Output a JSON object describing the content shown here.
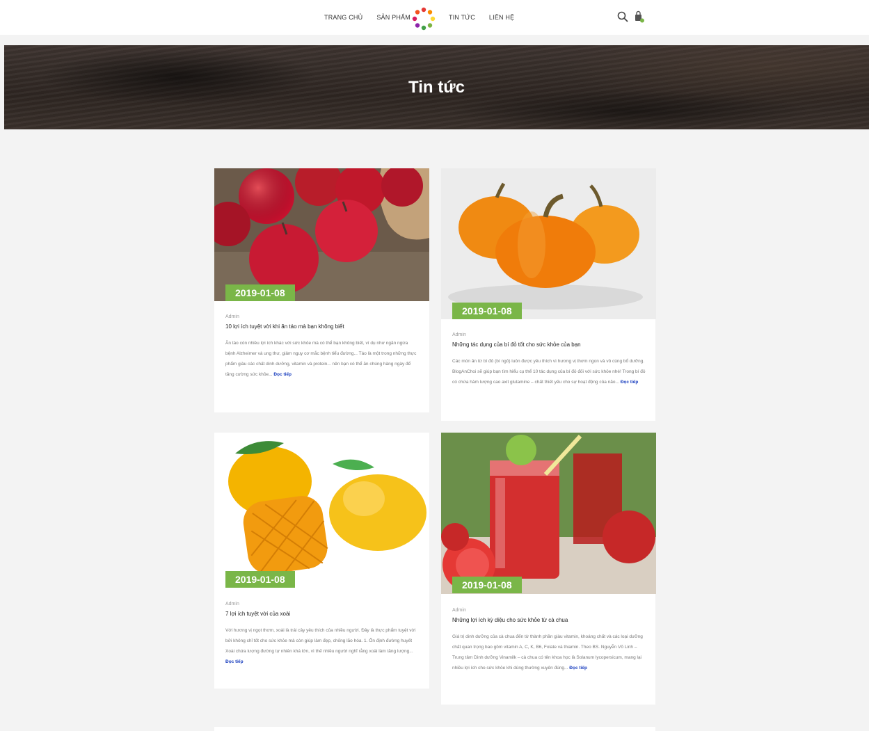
{
  "nav": {
    "left": [
      "TRANG CHỦ",
      "SẢN PHẨM"
    ],
    "right": [
      "TIN TỨC",
      "LIÊN HỆ"
    ]
  },
  "header_icons": [
    "search-icon",
    "cart-icon"
  ],
  "hero": {
    "title": "Tin tức"
  },
  "colors": {
    "accent_green": "#7ab648",
    "read_more": "#1a3fbf",
    "hero_bg": "#2e2622"
  },
  "posts": [
    {
      "image": "apples",
      "date": "2019-01-08",
      "author": "Admin",
      "title": "10 lợi ích tuyệt vời khi ăn táo mà bạn không biết",
      "excerpt": "Ăn táo còn nhiều lợi ích khác với sức khỏe mà có thể bạn không biết, ví dụ như ngăn ngừa bệnh Alzheimer và ung thư, giảm nguy cơ mắc bệnh tiểu đường... Táo là một trong những thực phẩm giàu các chất dinh dưỡng, vitamin và protein... nên bạn có thể ăn chúng hàng ngày để tăng cường sức khỏe...",
      "more": "Đọc tiếp"
    },
    {
      "image": "pumpkins",
      "date": "2019-01-08",
      "author": "Admin",
      "title": "Những tác dụng của bí đỏ tốt cho sức khỏe của bạn",
      "excerpt": "Các món ăn từ bí đỏ (bí ngô) luôn được yêu thích vì hương vị thơm ngon và vô cùng bổ dưỡng. BlogAnChoi sẽ giúp bạn tìm hiểu cụ thể 10 tác dụng của bí đỏ đối với sức khỏe nhé! Trong bí đỏ có chứa hàm lượng cao axit glutamine – chất thiết yếu cho sự hoạt động của não...",
      "more": "Đọc tiếp"
    },
    {
      "image": "mangoes",
      "date": "2019-01-08",
      "author": "Admin",
      "title": "7 lợi ích tuyệt vời của xoài",
      "excerpt": "Với hương vị ngọt thơm, xoài là trái cây yêu thích của nhiều người. Đây là thực phẩm tuyệt vời bởi không chỉ tốt cho sức khỏe mà còn giúp làm đẹp, chống lão hóa. 1. Ổn định đường huyết Xoài chứa lượng đường tự nhiên khá lớn, vì thế nhiều người nghĩ rằng xoài làm tăng lượng...",
      "more": "Đọc tiếp"
    },
    {
      "image": "tomato-juice",
      "date": "2019-01-08",
      "author": "Admin",
      "title": "Những lợi ích kỳ diệu cho sức khỏe từ cà chua",
      "excerpt": "Giá trị dinh dưỡng của cà chua đến từ thành phần giàu vitamin, khoáng chất và các loại dưỡng chất quan trọng bao gồm vitamin A, C, K, B6, Folate và thiamin. Theo BS. Nguyễn Võ Linh – Trung tâm Dinh dưỡng Vinamilk – cà chua có tên khoa học là Solanum lycopersicum, mang lại nhiều lợi ích cho sức khỏe khi dùng thường xuyên đúng...",
      "more": "Đọc tiếp"
    }
  ]
}
